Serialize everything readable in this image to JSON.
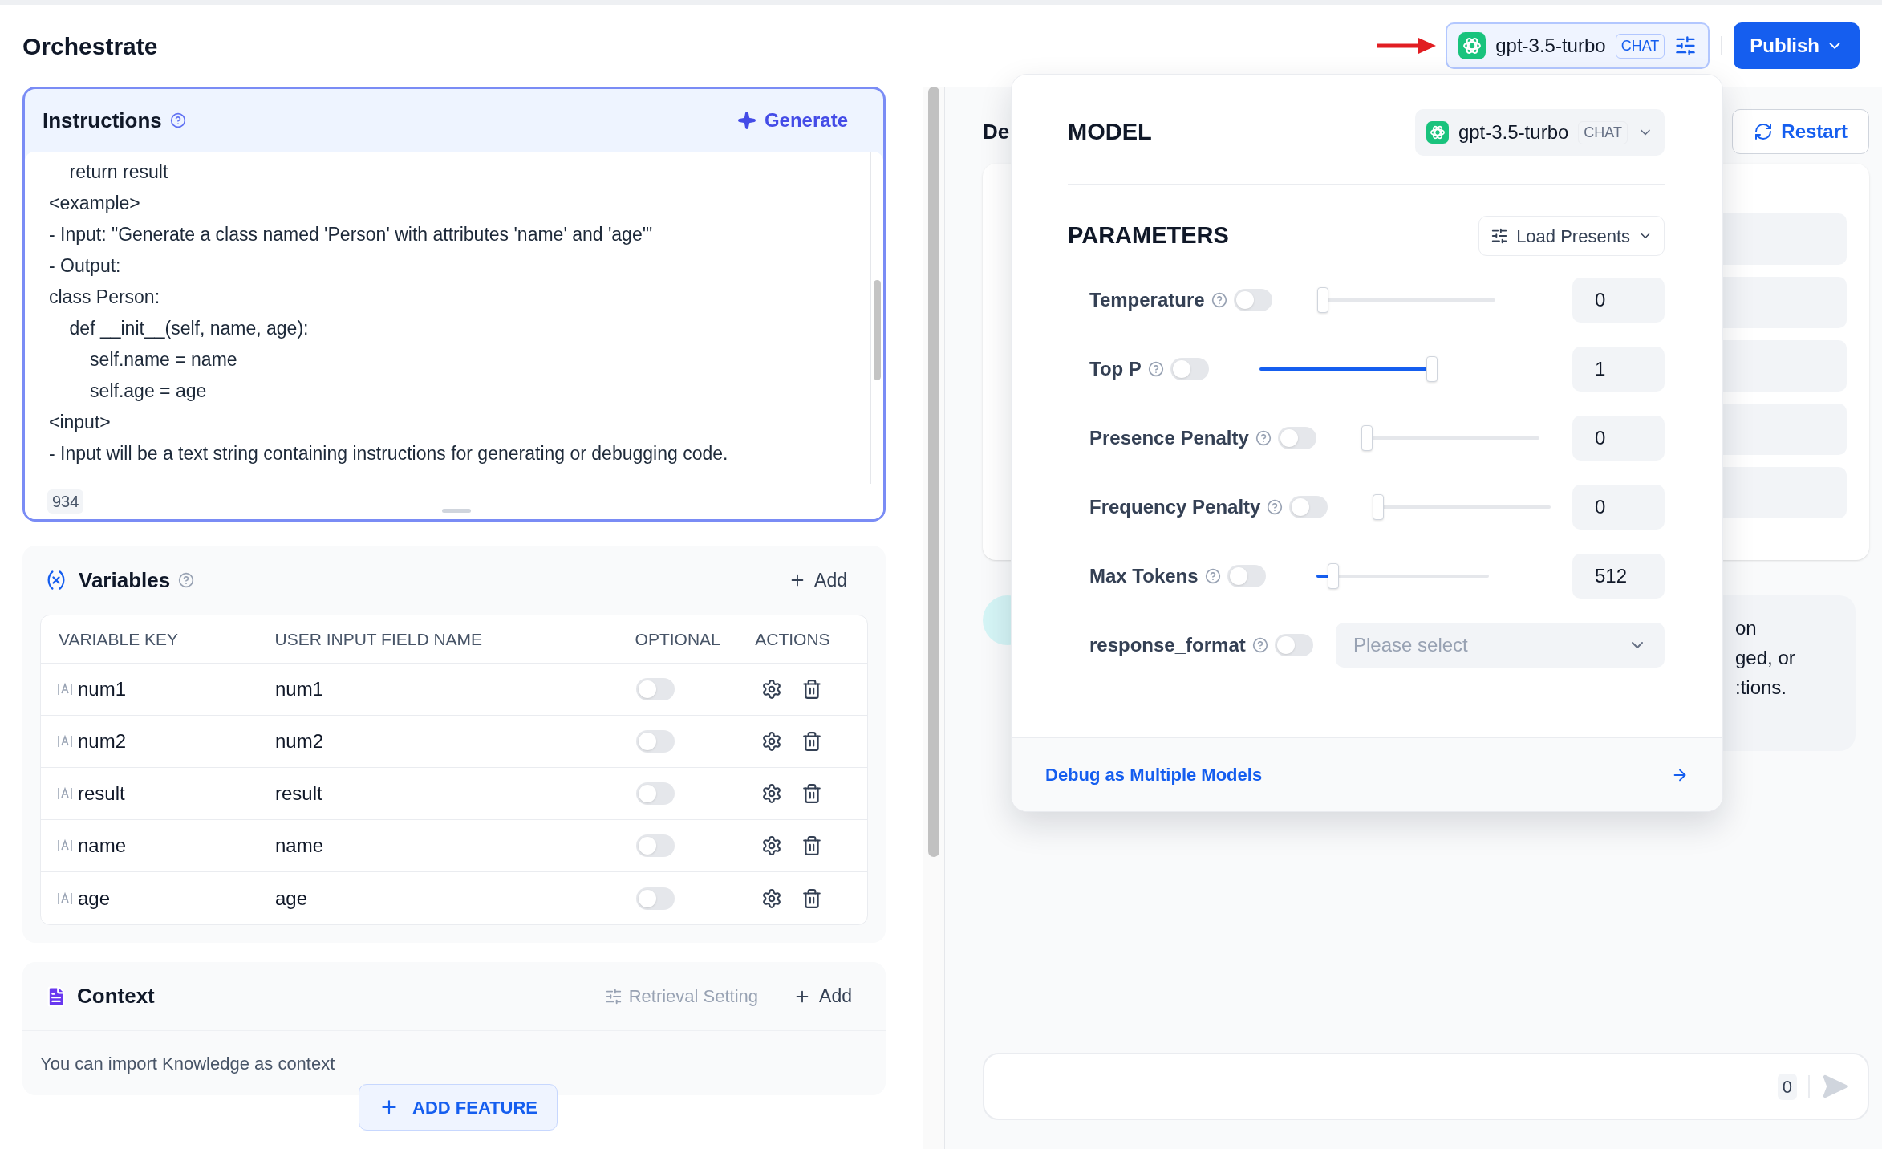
{
  "page_title": "Orchestrate",
  "model_button": {
    "model": "gpt-3.5-turbo",
    "mode": "CHAT"
  },
  "publish": {
    "label": "Publish"
  },
  "instructions": {
    "title": "Instructions",
    "generate": "Generate",
    "count": "934",
    "lines": [
      "    return result",
      "<example>",
      "- Input: \"Generate a class named 'Person' with attributes 'name' and 'age'\"",
      "- Output:",
      "class Person:",
      "    def __init__(self, name, age):",
      "        self.name = name",
      "        self.age = age",
      "<input>",
      "- Input will be a text string containing instructions for generating or debugging code."
    ]
  },
  "variables": {
    "title": "Variables",
    "add": "Add",
    "columns": [
      "VARIABLE KEY",
      "USER INPUT FIELD NAME",
      "OPTIONAL",
      "ACTIONS"
    ],
    "rows": [
      {
        "key": "num1",
        "name": "num1",
        "optional": false
      },
      {
        "key": "num2",
        "name": "num2",
        "optional": false
      },
      {
        "key": "result",
        "name": "result",
        "optional": false
      },
      {
        "key": "name",
        "name": "name",
        "optional": false
      },
      {
        "key": "age",
        "name": "age",
        "optional": false
      }
    ]
  },
  "context": {
    "title": "Context",
    "retrieval": "Retrieval Setting",
    "add": "Add",
    "hint": "You can import Knowledge as context"
  },
  "add_feature": "ADD FEATURE",
  "debug": {
    "title_fragment": "De",
    "restart": "Restart",
    "bubble_fragments": [
      "on",
      "ged, or",
      ":tions."
    ],
    "input_count": "0"
  },
  "popover": {
    "model_heading": "MODEL",
    "model": "gpt-3.5-turbo",
    "mode": "CHAT",
    "parameters_heading": "PARAMETERS",
    "load_presets": "Load Presents",
    "params": [
      {
        "kind": "slider",
        "label": "Temperature",
        "on": false,
        "level": 0,
        "value": "0"
      },
      {
        "kind": "slider",
        "label": "Top P",
        "on": false,
        "level": 1,
        "value": "1"
      },
      {
        "kind": "slider",
        "label": "Presence Penalty",
        "on": false,
        "level": 0,
        "value": "0"
      },
      {
        "kind": "slider",
        "label": "Frequency Penalty",
        "on": false,
        "level": 0,
        "value": "0"
      },
      {
        "kind": "slider",
        "label": "Max Tokens",
        "on": false,
        "level": 0.1,
        "value": "512"
      },
      {
        "kind": "select",
        "label": "response_format",
        "on": false,
        "placeholder": "Please select"
      }
    ],
    "footer_link": "Debug as Multiple Models"
  }
}
